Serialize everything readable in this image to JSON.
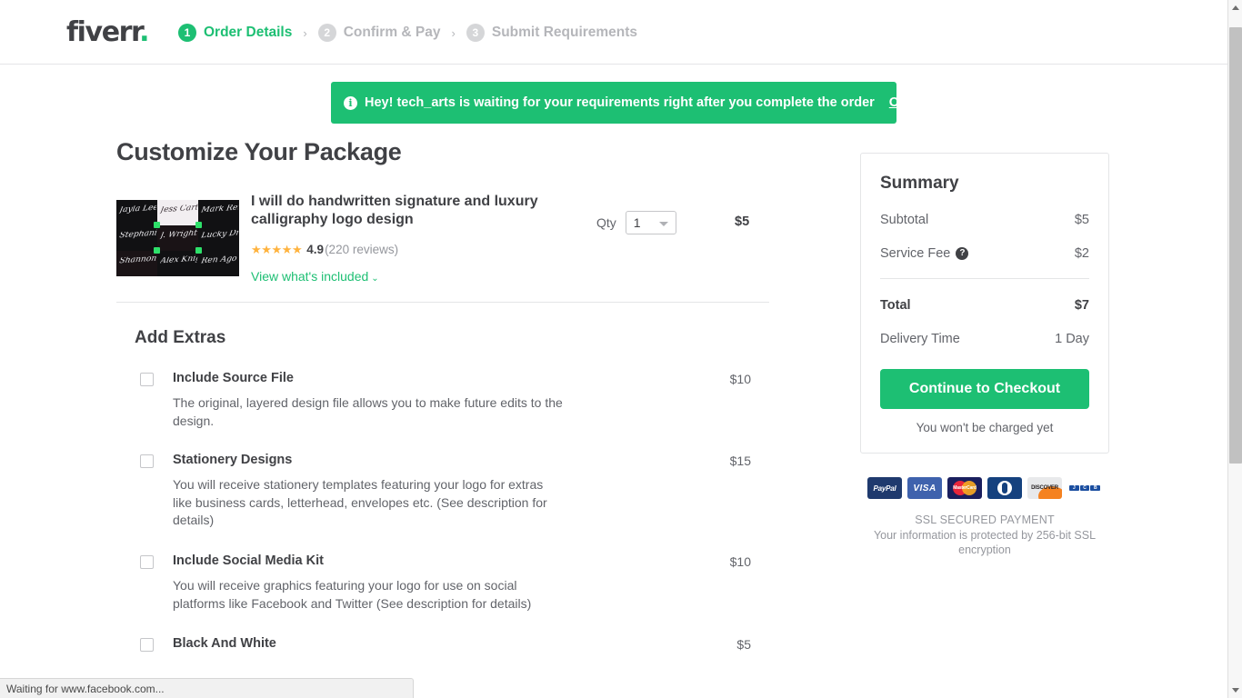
{
  "brand": {
    "logo_text": "fiverr",
    "logo_dot": ".",
    "accent_color": "#1dbf73",
    "text_color": "#404145"
  },
  "header": {
    "steps": [
      {
        "number": "1",
        "label": "Order Details",
        "state": "active"
      },
      {
        "number": "2",
        "label": "Confirm & Pay",
        "state": "inactive"
      },
      {
        "number": "3",
        "label": "Submit Requirements",
        "state": "inactive"
      }
    ],
    "separator": "›"
  },
  "banner": {
    "icon": "info-icon",
    "icon_glyph": "i",
    "message": "Hey! tech_arts is waiting for your requirements right after you complete the order",
    "action_label": "Ok, got it",
    "background_color": "#1dbf73"
  },
  "main": {
    "page_title": "Customize Your Package",
    "gig": {
      "title": "I will do handwritten signature and luxury calligraphy logo design",
      "stars": "★★★★★",
      "rating_value": "4.9",
      "review_count": "(220 reviews)",
      "included_link": "View what's included",
      "chevron": "⌄",
      "qty_label": "Qty",
      "qty_value": "1",
      "price": "$5",
      "thumbnail_alt": "signature-logo-samples-grid"
    },
    "extras": {
      "heading": "Add Extras",
      "items": [
        {
          "name": "Include Source File",
          "description": "The original, layered design file allows you to make future edits to the design.",
          "price": "$10",
          "checked": false
        },
        {
          "name": "Stationery Designs",
          "description": "You will receive stationery templates featuring your logo for extras like business cards, letterhead, envelopes etc. (See description for details)",
          "price": "$15",
          "checked": false
        },
        {
          "name": "Include Social Media Kit",
          "description": "You will receive graphics featuring your logo for use on social platforms like Facebook and Twitter (See description for details)",
          "price": "$10",
          "checked": false
        },
        {
          "name": "Black And White",
          "description": "",
          "price": "$5",
          "checked": false
        }
      ]
    }
  },
  "summary": {
    "title": "Summary",
    "rows": [
      {
        "label": "Subtotal",
        "value": "$5",
        "help": false
      },
      {
        "label": "Service Fee",
        "value": "$2",
        "help": true
      }
    ],
    "help_glyph": "?",
    "total_label": "Total",
    "total_value": "$7",
    "delivery_label": "Delivery Time",
    "delivery_value": "1 Day",
    "checkout_label": "Continue to Checkout",
    "charge_note": "You won't be charged yet"
  },
  "payment": {
    "methods": [
      {
        "name": "paypal-icon",
        "label": "PayPal"
      },
      {
        "name": "visa-icon",
        "label": "VISA"
      },
      {
        "name": "mastercard-icon",
        "label": "MasterCard"
      },
      {
        "name": "diners-club-icon",
        "label": "Diners Club"
      },
      {
        "name": "discover-icon",
        "label": "DISCOVER"
      },
      {
        "name": "jcb-icon",
        "label": "JCB"
      }
    ],
    "ssl_title": "SSL SECURED PAYMENT",
    "ssl_note": "Your information is protected by 256-bit SSL encryption"
  },
  "browser": {
    "status_text": "Waiting for www.facebook.com..."
  }
}
